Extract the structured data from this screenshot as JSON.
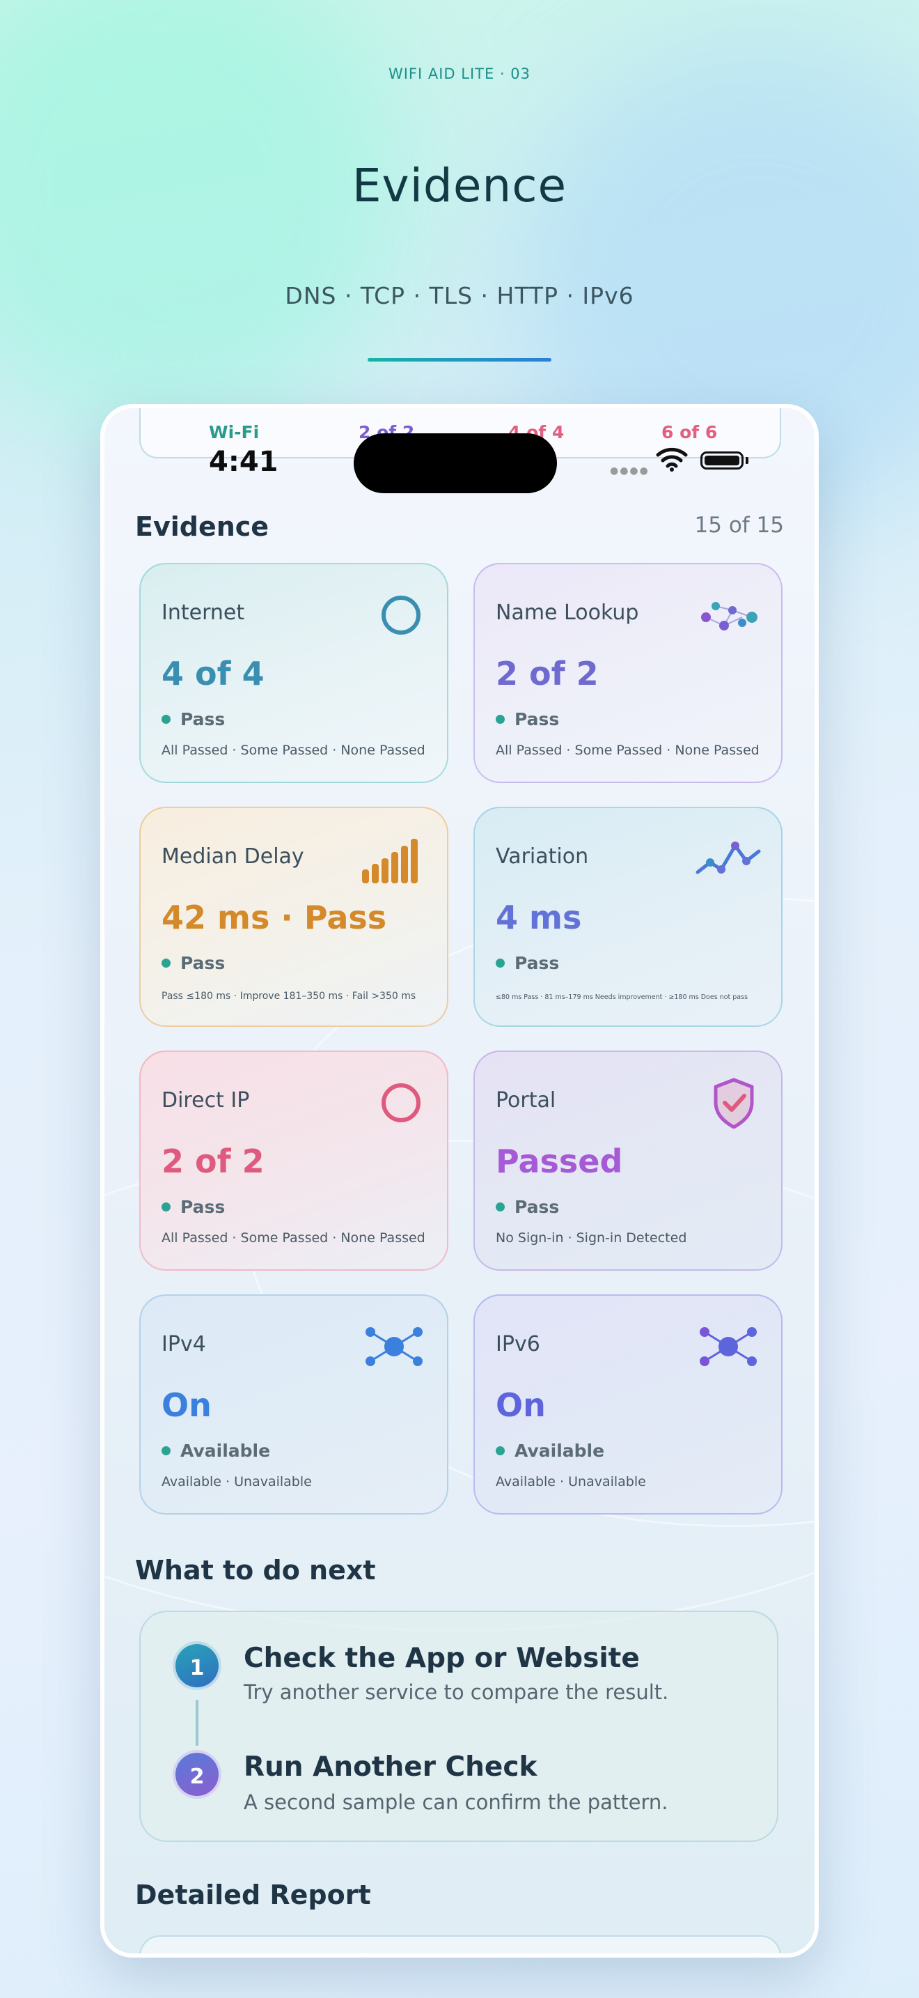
{
  "header": {
    "kicker": "WIFI AID LITE · 03",
    "title": "Evidence",
    "subtitle": "DNS · TCP · TLS · HTTP · IPv6"
  },
  "status_bar": {
    "time": "4:41",
    "peek_labels": [
      "Wi-Fi",
      "2 of 2",
      "4 of 4",
      "6 of 6"
    ]
  },
  "evidence": {
    "title": "Evidence",
    "count": "15 of 15",
    "cards": [
      {
        "label": "Internet",
        "value": "4 of 4",
        "status": "Pass",
        "legend": "All Passed · Some Passed · None Passed",
        "icon": "ring-icon",
        "color": "#3a8fb0"
      },
      {
        "label": "Name Lookup",
        "value": "2 of 2",
        "status": "Pass",
        "legend": "All Passed · Some Passed · None Passed",
        "icon": "dns-nodes-icon",
        "color": "#6f6ad0"
      },
      {
        "label": "Median Delay",
        "value": "42 ms · Pass",
        "status": "Pass",
        "legend": "Pass ≤180 ms · Improve 181–350 ms · Fail >350 ms",
        "icon": "signal-bars-icon",
        "color": "#d4892a"
      },
      {
        "label": "Variation",
        "value": "4 ms",
        "status": "Pass",
        "legend": "≤80 ms Pass · 81 ms–179 ms Needs improvement · ≥180 ms Does not pass",
        "icon": "line-graph-icon",
        "color": "#6372d6"
      },
      {
        "label": "Direct IP",
        "value": "2 of 2",
        "status": "Pass",
        "legend": "All Passed · Some Passed · None Passed",
        "icon": "ring-icon",
        "color": "#de5a7e"
      },
      {
        "label": "Portal",
        "value": "Passed",
        "status": "Pass",
        "legend": "No Sign-in · Sign-in Detected",
        "icon": "shield-check-icon",
        "color": "#a65ad6"
      },
      {
        "label": "IPv4",
        "value": "On",
        "status": "Available",
        "legend": "Available · Unavailable",
        "icon": "network-hub-icon",
        "color": "#3a80dc"
      },
      {
        "label": "IPv6",
        "value": "On",
        "status": "Available",
        "legend": "Available · Unavailable",
        "icon": "network-hub-icon",
        "color": "#5e64dc"
      }
    ]
  },
  "next_steps": {
    "title": "What to do next",
    "steps": [
      {
        "number": "1",
        "title": "Check the App or Website",
        "description": "Try another service to compare the result."
      },
      {
        "number": "2",
        "title": "Run Another Check",
        "description": "A second sample can confirm the pattern."
      }
    ]
  },
  "report": {
    "title": "Detailed Report"
  },
  "colors": {
    "accent_teal": "#17b3a3",
    "accent_blue": "#2b7fd8",
    "pass_dot": "#2aa393",
    "step1": "#2e8fbb",
    "step2": "#7a6ad6"
  }
}
